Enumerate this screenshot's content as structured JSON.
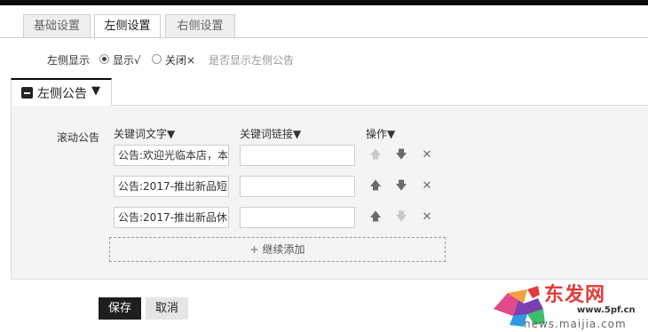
{
  "tabs": [
    {
      "label": "基础设置",
      "active": false
    },
    {
      "label": "左侧设置",
      "active": true
    },
    {
      "label": "右侧设置",
      "active": false
    }
  ],
  "left_display": {
    "label": "左侧显示",
    "option_show": "显示√",
    "option_hide": "关闭×",
    "selected": "show",
    "hint": "是否显示左侧公告"
  },
  "section": {
    "title": "左侧公告",
    "caret": "▼"
  },
  "scroll_notice": {
    "label": "滚动公告",
    "columns": {
      "keyword_text": "关键词文字▼",
      "keyword_link": "关键词链接▼",
      "action": "操作▼"
    },
    "rows": [
      {
        "text": "公告:欢迎光临本店，本",
        "link": "",
        "up_enabled": false,
        "down_enabled": true
      },
      {
        "text": "公告:2017-推出新品短",
        "link": "",
        "up_enabled": true,
        "down_enabled": true
      },
      {
        "text": "公告:2017-推出新品休",
        "link": "",
        "up_enabled": true,
        "down_enabled": false
      }
    ],
    "add_label": "继续添加"
  },
  "buttons": {
    "save": "保存",
    "cancel": "取消"
  },
  "watermark": {
    "brand": "东发网",
    "url1": "www.5pf.cn",
    "url2": "news.maijia.com"
  },
  "colors": {
    "accent_dark": "#1e1e1e",
    "panel_bg": "#f4f4f4",
    "brand_red": "#e23b3b"
  }
}
